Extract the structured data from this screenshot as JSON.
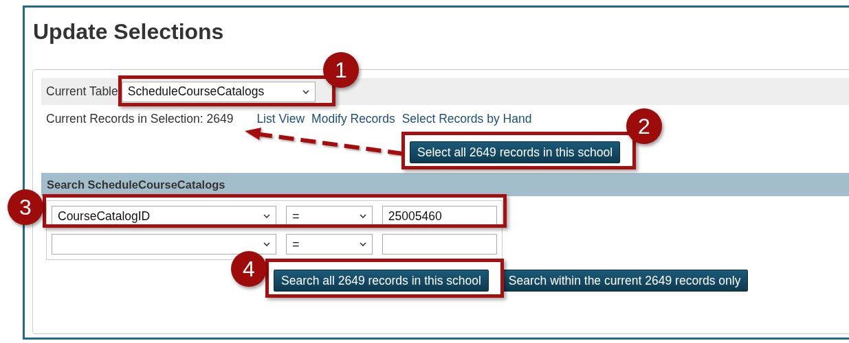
{
  "page": {
    "title": "Update Selections"
  },
  "current_table": {
    "label": "Current Table",
    "value": "ScheduleCourseCatalogs"
  },
  "selection": {
    "text": "Current Records in Selection: 2649",
    "links": [
      "List View",
      "Modify Records",
      "Select Records by Hand"
    ]
  },
  "select_all_button": "Select all 2649 records in this school",
  "search": {
    "heading": "Search ScheduleCourseCatalogs",
    "rows": [
      {
        "field": "CourseCatalogID",
        "operator": "=",
        "value": "25005460"
      },
      {
        "operator": "="
      }
    ],
    "buttons": [
      "Search all 2649 records in this school",
      "Search within the current 2649 records only"
    ]
  },
  "callouts": [
    "1",
    "2",
    "3",
    "4"
  ]
}
